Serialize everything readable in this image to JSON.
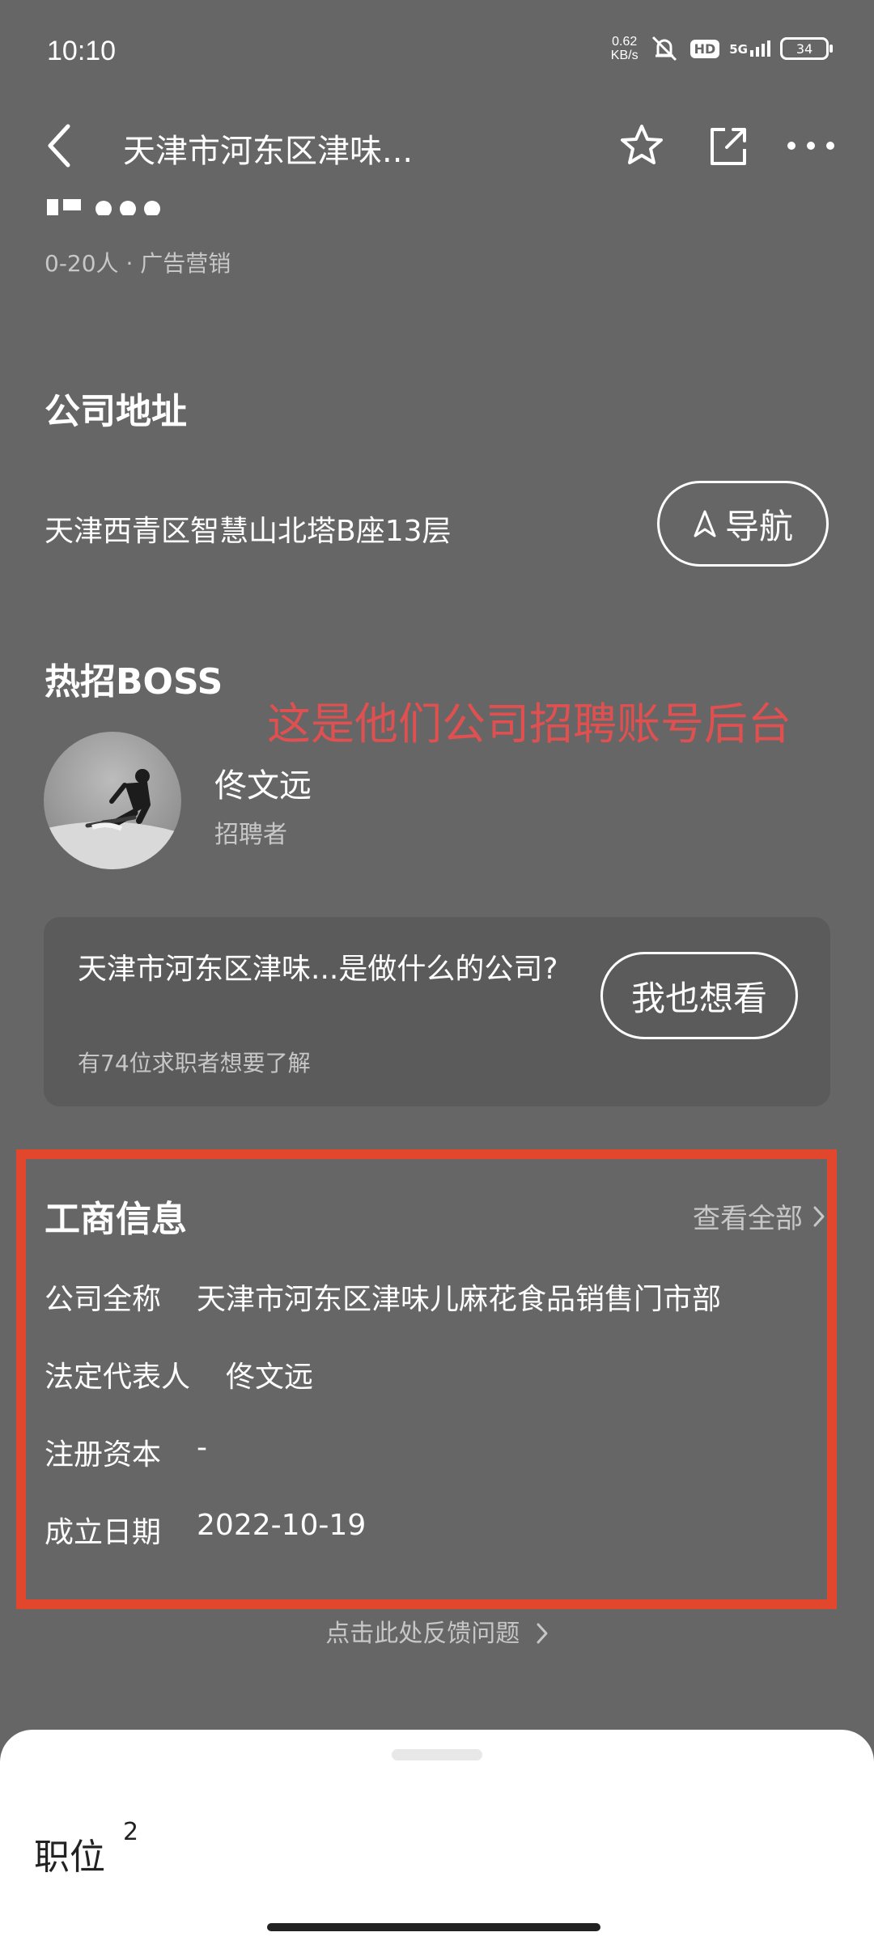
{
  "status_bar": {
    "time": "10:10",
    "net_speed_value": "0.62",
    "net_speed_unit": "KB/s",
    "hd": "HD",
    "signal": "5G",
    "battery": "34"
  },
  "nav": {
    "title": "天津市河东区津味..."
  },
  "company": {
    "meta": "0-20人 · 广告营销"
  },
  "address": {
    "section_title": "公司地址",
    "text": "天津西青区智慧山北塔B座13层",
    "nav_button": "导航"
  },
  "annotation": "这是他们公司招聘账号后台",
  "hot_boss": {
    "section_title": "热招BOSS",
    "name": "佟文远",
    "role": "招聘者"
  },
  "ask_card": {
    "question": "天津市河东区津味...是做什么的公司?",
    "subtext": "有74位求职者想要了解",
    "button": "我也想看"
  },
  "business_info": {
    "section_title": "工商信息",
    "view_all": "查看全部",
    "rows": [
      {
        "label": "公司全称",
        "value": "天津市河东区津味儿麻花食品销售门市部"
      },
      {
        "label": "法定代表人",
        "value": "佟文远"
      },
      {
        "label": "注册资本",
        "value": "-"
      },
      {
        "label": "成立日期",
        "value": "2022-10-19"
      }
    ]
  },
  "feedback": "点击此处反馈问题",
  "bottom_sheet": {
    "title": "职位",
    "count": "2"
  },
  "colors": {
    "background": "#666666",
    "annotation_red": "#e05050",
    "highlight_box": "#e2462c",
    "card": "#5b5b5b"
  }
}
